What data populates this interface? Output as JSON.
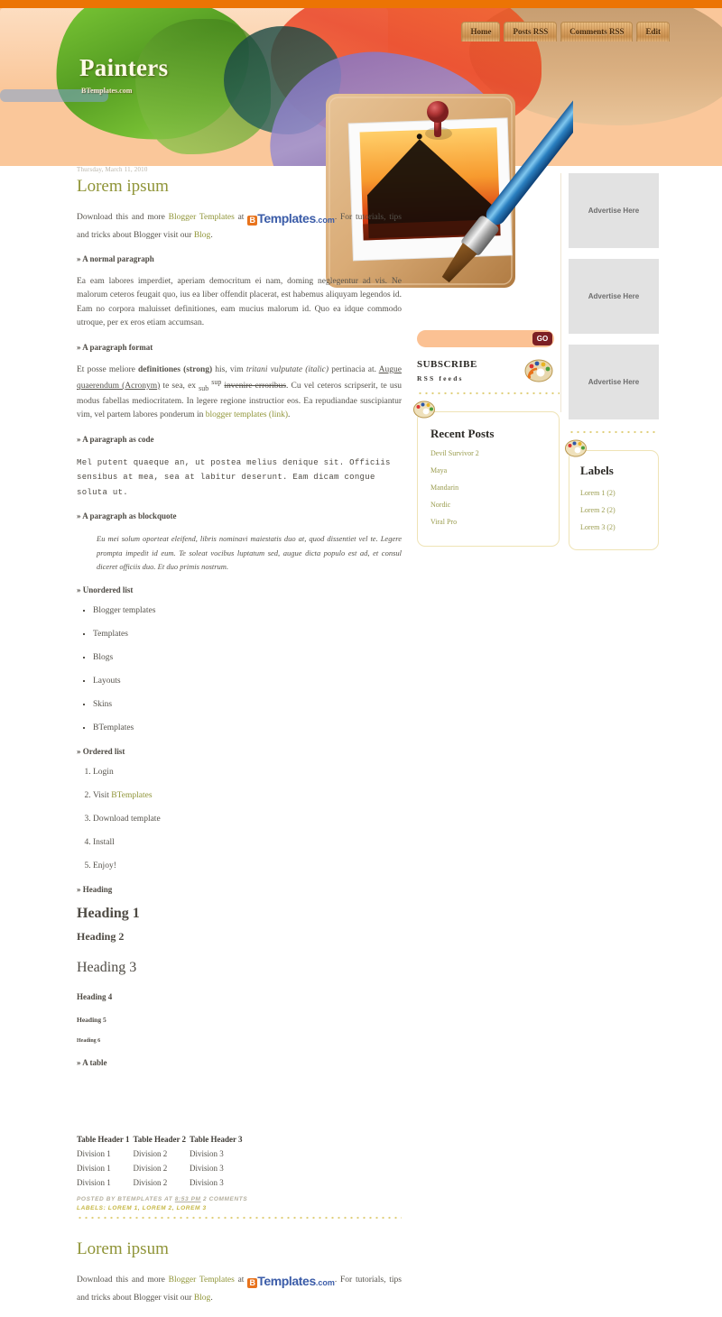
{
  "colors": {
    "topbar": "#ec7404",
    "header_bg": "#fac79a",
    "accent_green": "#8f9437",
    "go_button": "#7c1f24",
    "search_bg": "#fbc193",
    "widget_border": "#efe3b5"
  },
  "header": {
    "title": "Painters",
    "subtitle": "BTemplates.com"
  },
  "nav": {
    "items": [
      {
        "label": "Home"
      },
      {
        "label": "Posts RSS"
      },
      {
        "label": "Comments RSS"
      },
      {
        "label": "Edit"
      }
    ]
  },
  "posts": [
    {
      "date": "Thursday, March 11, 2010",
      "title": "Lorem ipsum",
      "intro_pre": "Download this and more ",
      "intro_link1": "Blogger Templates",
      "intro_mid": " at ",
      "logo_mark": "B",
      "logo_name": "Templates",
      "logo_tld": ".com",
      "intro_post": ". For tutorials, tips and tricks about Blogger visit our ",
      "intro_link2": "Blog",
      "intro_end": ".",
      "sections": {
        "normal_paragraph_head": "» A normal paragraph",
        "normal_paragraph": "Ea eam labores imperdiet, aperiam democritum ei nam, doming neglegentur ad vis. Ne malorum ceteros feugait quo, ius ea liber offendit placerat, est habemus aliquyam legendos id. Eam no corpora maluisset definitiones, eam mucius malorum id. Quo ea idque commodo utroque, per ex eros etiam accumsan.",
        "format_head": "» A paragraph format",
        "format_p1": "Et posse meliore ",
        "format_strong": "definitiones (strong)",
        "format_p2": " his, vim ",
        "format_italic": "tritani vulputate (italic)",
        "format_p3": " pertinacia at. ",
        "format_acronym": "Augue quaerendum (Acronym)",
        "format_p4": " te sea, ex ",
        "format_sub": "sub",
        "format_sup": "sup",
        "format_strike": "invenire erroribus",
        "format_p5": ". Cu vel ceteros scripserit, te usu modus fabellas mediocritatem. In legere regione instructior eos. Ea repudiandae suscipiantur vim, vel partem labores ponderum in ",
        "format_link": "blogger templates (link)",
        "format_p6": ".",
        "code_head": "» A paragraph as code",
        "code_text": "Mel putent quaeque an, ut postea melius denique sit. Officiis sensibus at mea, sea at labitur deserunt. Eam dicam congue soluta ut.",
        "blockquote_head": "» A paragraph as blockquote",
        "blockquote_text": "Eu mei solum oporteat eleifend, libris nominavi maiestatis duo at, quod dissentiet vel te. Legere prompta impedit id eum. Te soleat vocibus luptatum sed, augue dicta populo est ad, et consul diceret officiis duo. Et duo primis nostrum.",
        "ul_head": "» Unordered list",
        "ul_items": [
          "Blogger templates",
          "Templates",
          "Blogs",
          "Layouts",
          "Skins",
          "BTemplates"
        ],
        "ol_head": "» Ordered list",
        "ol_items": [
          "Login",
          "Visit BTemplates",
          "Download template",
          "Install",
          "Enjoy!"
        ],
        "ol_item2_pre": "Visit ",
        "ol_item2_link": "BTemplates",
        "heading_head": "» Heading",
        "h1": "Heading 1",
        "h2": "Heading 2",
        "h3": "Heading 3",
        "h4": "Heading 4",
        "h5": "Heading 5",
        "h6": "Heading 6",
        "table_head": "» A table"
      },
      "table": {
        "headers": [
          "Table Header 1",
          "Table Header 2",
          "Table Header 3"
        ],
        "rows": [
          [
            "Division 1",
            "Division 2",
            "Division 3"
          ],
          [
            "Division 1",
            "Division 2",
            "Division 3"
          ],
          [
            "Division 1",
            "Division 2",
            "Division 3"
          ]
        ]
      },
      "footer": {
        "posted_by": "POSTED BY BTEMPLATES AT ",
        "time": "8:53 PM",
        "comments": " 2 COMMENTS",
        "labels": "LABELS: LOREM 1, LOREM 2, LOREM 3"
      }
    },
    {
      "title": "Lorem ipsum",
      "intro_pre": "Download this and more ",
      "intro_link1": "Blogger Templates",
      "intro_mid": " at ",
      "logo_mark": "B",
      "logo_name": "Templates",
      "logo_tld": ".com",
      "intro_post": ". For tutorials, tips and tricks about Blogger visit our ",
      "intro_link2": "Blog",
      "intro_end": "."
    }
  ],
  "sidebar_mid": {
    "search": {
      "value": "",
      "placeholder": "",
      "button_label": "GO"
    },
    "subscribe": {
      "title": "SUBSCRIBE",
      "subtitle": "RSS feeds"
    },
    "recent_posts": {
      "title": "Recent Posts",
      "items": [
        "Devil Survivor 2",
        "Maya",
        "Mandarin",
        "Nordic",
        "Viral Pro"
      ]
    }
  },
  "sidebar_right": {
    "ads": [
      {
        "label": "Advertise Here"
      },
      {
        "label": "Advertise Here"
      },
      {
        "label": "Advertise Here"
      }
    ],
    "labels": {
      "title": "Labels",
      "items": [
        "Lorem 1 (2)",
        "Lorem 2 (2)",
        "Lorem 3 (2)"
      ]
    }
  }
}
